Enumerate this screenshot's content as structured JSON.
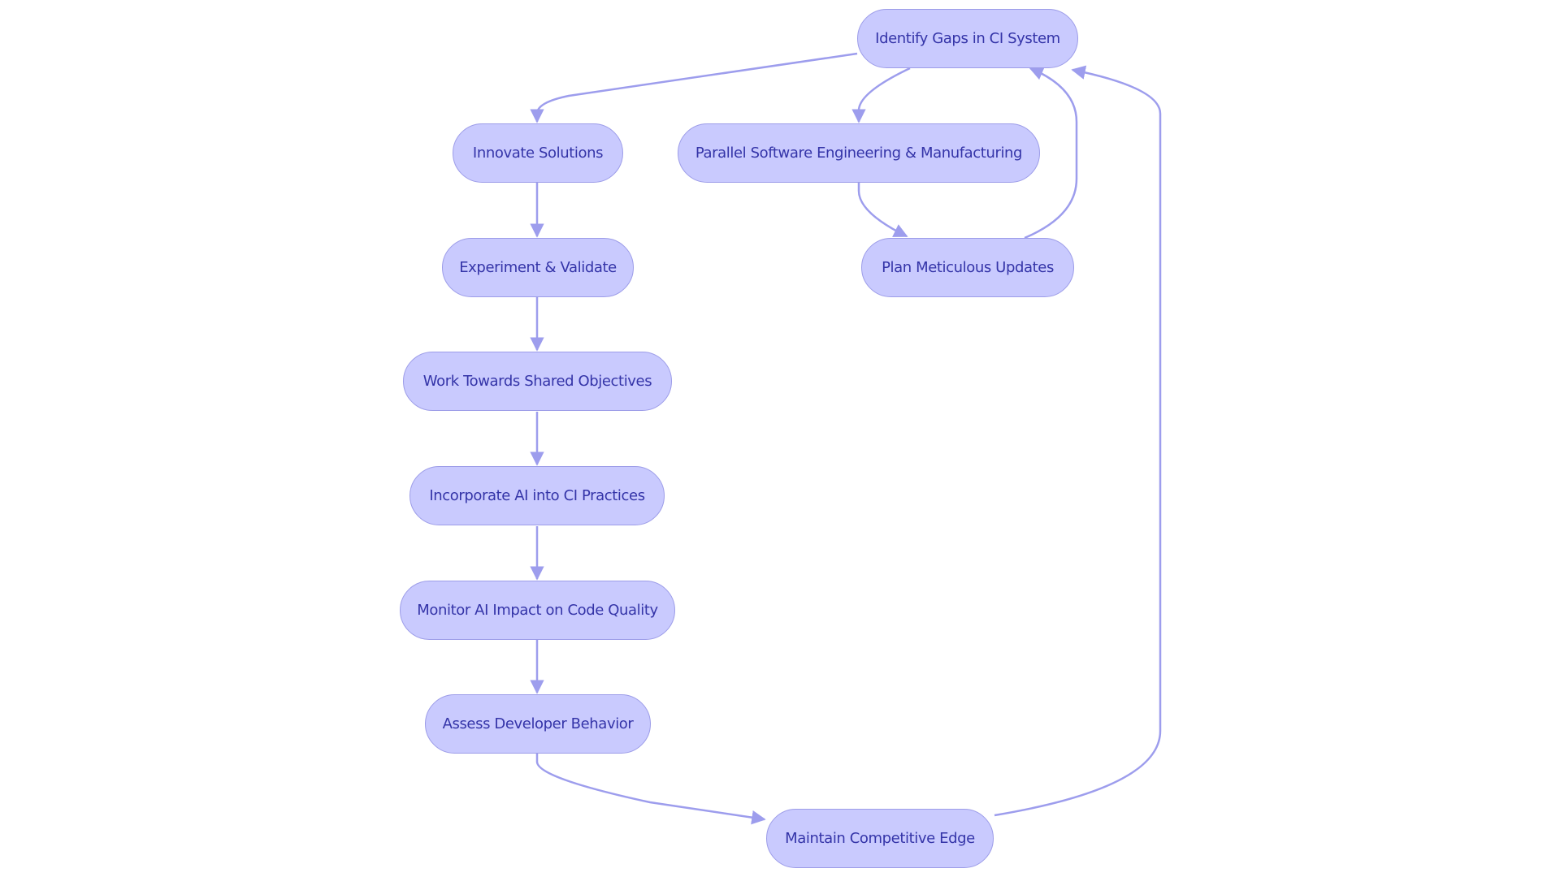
{
  "colors": {
    "node_fill": "#c9cafe",
    "node_stroke": "#9c9ce8",
    "node_text": "#3434a8",
    "edge": "#9d9ded"
  },
  "nodes": {
    "identify": "Identify Gaps in CI System",
    "innovate": "Innovate Solutions",
    "parallel": "Parallel Software Engineering & Manufacturing",
    "experiment": "Experiment & Validate",
    "plan": "Plan Meticulous Updates",
    "work": "Work Towards Shared Objectives",
    "incorporate": "Incorporate AI into CI Practices",
    "monitor": "Monitor AI Impact on Code Quality",
    "assess": "Assess Developer Behavior",
    "maintain": "Maintain Competitive Edge"
  },
  "edges": [
    {
      "from": "identify",
      "to": "innovate"
    },
    {
      "from": "identify",
      "to": "parallel"
    },
    {
      "from": "innovate",
      "to": "experiment"
    },
    {
      "from": "parallel",
      "to": "plan"
    },
    {
      "from": "plan",
      "to": "identify"
    },
    {
      "from": "experiment",
      "to": "work"
    },
    {
      "from": "work",
      "to": "incorporate"
    },
    {
      "from": "incorporate",
      "to": "monitor"
    },
    {
      "from": "monitor",
      "to": "assess"
    },
    {
      "from": "assess",
      "to": "maintain"
    },
    {
      "from": "maintain",
      "to": "identify"
    }
  ]
}
